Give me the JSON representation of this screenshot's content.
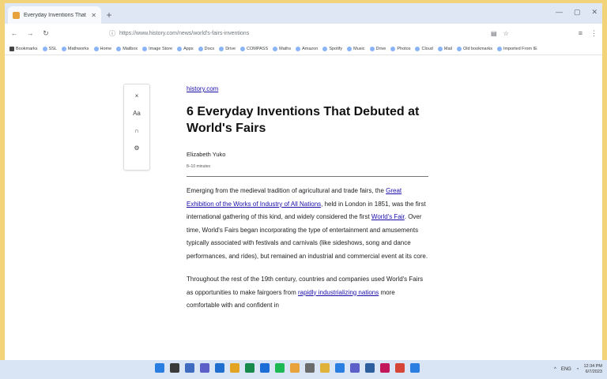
{
  "browser": {
    "tab_title": "Everyday Inventions That De...",
    "url": "https://www.history.com/news/world's-fairs-inventions",
    "bookmarks": [
      "Bookmarks",
      "SSL",
      "Mathworks",
      "Home",
      "Mailbox",
      "Image Store",
      "Apps",
      "Docs",
      "Drive",
      "COMPASS",
      "Maths",
      "Amazon",
      "Spotify",
      "Music",
      "Drive",
      "Photos",
      "Cloud",
      "Mail",
      "Old bookmarks",
      "Imported From IE"
    ]
  },
  "sidebar_tools": {
    "close": "×",
    "text_size": "Aa",
    "listen": "∩",
    "settings": "⚙"
  },
  "article": {
    "source": "history.com",
    "title": "6 Everyday Inventions That Debuted at World's Fairs",
    "author": "Elizabeth Yuko",
    "read_time": "8–10 minutes",
    "p1": [
      {
        "t": "Emerging from the medieval tradition of agricultural and trade fairs, the "
      },
      {
        "t": "Great Exhibition of the Works of Industry of All Nations",
        "link": true
      },
      {
        "t": ", held in London in 1851, was the first international gathering of this kind, and widely considered the first "
      },
      {
        "t": "World's Fair",
        "link": true
      },
      {
        "t": ". Over time, World's Fairs began incorporating the type of entertainment and amusements typically associated with festivals and carnivals (like sideshows, song and dance performances, and rides), but remained an industrial and commercial event at its core."
      }
    ],
    "p2": [
      {
        "t": "Throughout the rest of the 19th century, countries and companies used World's Fairs as opportunities to make fairgoers from "
      },
      {
        "t": "rapidly industrializing nations",
        "link": true
      },
      {
        "t": " more comfortable with and confident in"
      }
    ]
  },
  "taskbar": {
    "icons": [
      {
        "name": "windows-start-icon",
        "color": "#2a7de1"
      },
      {
        "name": "search-icon",
        "color": "#3b3b3b"
      },
      {
        "name": "task-view-icon",
        "color": "#3f6cc1"
      },
      {
        "name": "chat-icon",
        "color": "#5b5fc7"
      },
      {
        "name": "file-explorer-icon",
        "color": "#1f6fd1"
      },
      {
        "name": "store-icon",
        "color": "#e3a323"
      },
      {
        "name": "edge-icon",
        "color": "#178a4c"
      },
      {
        "name": "mail-icon",
        "color": "#1b6ed6"
      },
      {
        "name": "spotify-icon",
        "color": "#1db954"
      },
      {
        "name": "chrome-icon",
        "color": "#e8a33d"
      },
      {
        "name": "settings-icon",
        "color": "#6b6b6b"
      },
      {
        "name": "folder-icon",
        "color": "#e0b23a"
      },
      {
        "name": "vscode-icon",
        "color": "#2a7de1"
      },
      {
        "name": "teams-icon",
        "color": "#5b5fc7"
      },
      {
        "name": "photos-icon",
        "color": "#2d5f9e"
      },
      {
        "name": "slack-icon",
        "color": "#c2185b"
      },
      {
        "name": "office-icon",
        "color": "#d64535"
      },
      {
        "name": "app-icon",
        "color": "#2a7de1"
      }
    ],
    "tray_text": "ENG",
    "time": "12:34 PM",
    "date": "6/7/2023"
  }
}
